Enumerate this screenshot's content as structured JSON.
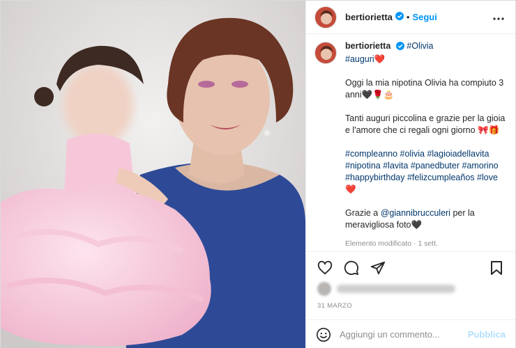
{
  "header": {
    "username": "bertiorietta",
    "separator": "•",
    "follow_label": "Segui",
    "more_icon": "more-horizontal-icon",
    "verified_icon": "verified-badge-icon"
  },
  "caption": {
    "username": "bertiorietta",
    "hashtag_olivia": "#Olivia",
    "hashtag_auguri": "#auguri",
    "heart_emoji": "❤️",
    "line1": "Oggi la mia nipotina Olivia ha compiuto 3 anni",
    "line1_emojis": "🖤🌹🎂",
    "line2": "Tanti auguri piccolina e grazie per la gioia e l'amore che ci regali ogni giorno",
    "line2_emojis": "🎀🎁",
    "hashtags_line": "#compleanno #olivia #lagioiadellavita #nipotina #lavita #panedbuter #amorino #happybirthday #felizcumpleaños #love",
    "hashtags_emoji": "❤️",
    "thanks_prefix": "Grazie a ",
    "thanks_mention": "@giannibrucculeri",
    "thanks_suffix": " per la meravigliosa foto",
    "thanks_emoji": "🖤",
    "meta": "Elemento modificato · 1 sett."
  },
  "actions": {
    "like_icon": "heart-icon",
    "comment_icon": "comment-icon",
    "share_icon": "share-icon",
    "save_icon": "bookmark-icon"
  },
  "date": "31 MARZO",
  "comment_box": {
    "emoji_icon": "emoji-smile-icon",
    "placeholder": "Aggiungi un commento...",
    "publish_label": "Pubblica"
  },
  "colors": {
    "accent": "#0095f6",
    "publish_disabled": "#b2dffc",
    "hashtag": "#00376b",
    "muted": "#8e8e8e",
    "border": "#dbdbdb"
  }
}
